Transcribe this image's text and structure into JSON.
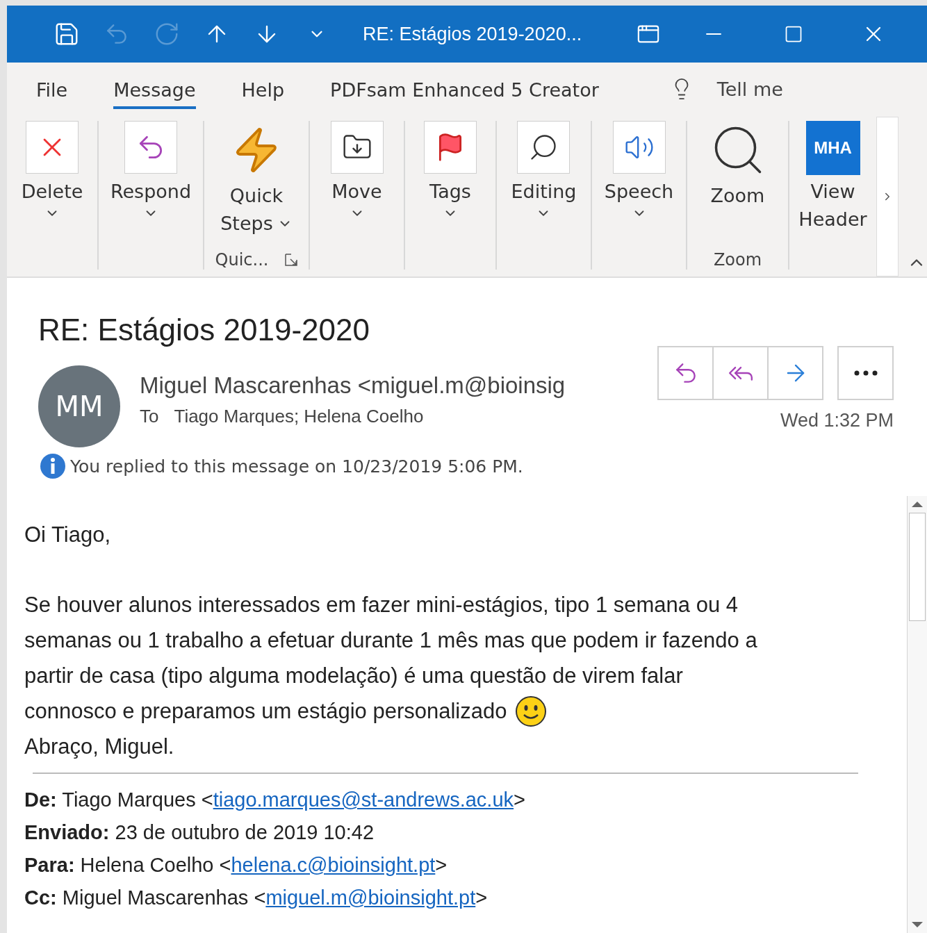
{
  "window": {
    "title": "RE: Estágios 2019-2020..."
  },
  "tabs": [
    {
      "label": "File",
      "selected": false
    },
    {
      "label": "Message",
      "selected": true
    },
    {
      "label": "Help",
      "selected": false
    },
    {
      "label": "PDFsam Enhanced 5 Creator",
      "selected": false
    }
  ],
  "tell_me": "Tell me",
  "ribbon": {
    "groups": [
      {
        "buttons": [
          {
            "lines": [
              "Delete"
            ],
            "dropdown": true
          }
        ]
      },
      {
        "buttons": [
          {
            "lines": [
              "Respond"
            ],
            "dropdown": true
          }
        ]
      },
      {
        "label": "Quic...",
        "buttons": [
          {
            "lines": [
              "Quick",
              "Steps"
            ],
            "dropdown": true
          }
        ]
      },
      {
        "buttons": [
          {
            "lines": [
              "Move"
            ],
            "dropdown": true
          }
        ]
      },
      {
        "buttons": [
          {
            "lines": [
              "Tags"
            ],
            "dropdown": true
          }
        ]
      },
      {
        "buttons": [
          {
            "lines": [
              "Editing"
            ],
            "dropdown": true
          }
        ]
      },
      {
        "buttons": [
          {
            "lines": [
              "Speech"
            ],
            "dropdown": true
          }
        ]
      },
      {
        "label": "Zoom",
        "buttons": [
          {
            "lines": [
              "Zoom"
            ],
            "dropdown": false
          }
        ]
      },
      {
        "buttons": [
          {
            "lines": [
              "View",
              "Header"
            ],
            "dropdown": false,
            "badge": "MHA"
          }
        ]
      }
    ]
  },
  "message": {
    "subject": "RE: Estágios 2019-2020",
    "avatar": "MM",
    "from": "Miguel Mascarenhas <miguel.m@bioinsig",
    "to_label": "To",
    "to": "Tiago Marques; Helena Coelho",
    "time": "Wed 1:32 PM",
    "info": "You replied to this message on 10/23/2019 5:06 PM.",
    "body": {
      "greeting": "Oi Tiago,",
      "paragraph_lines": [
        "Se houver alunos interessados em fazer mini-estágios, tipo 1 semana ou 4",
        "semanas ou 1 trabalho a efetuar durante 1 mês mas que podem ir fazendo a",
        "partir de casa (tipo alguma modelação) é uma questão de virem falar",
        "connosco e preparamos um estágio personalizado"
      ],
      "signoff": "Abraço, Miguel."
    },
    "quoted": [
      {
        "label": "De:",
        "before": "Tiago Marques <",
        "link": "tiago.marques@st-andrews.ac.uk",
        "after": ">"
      },
      {
        "label": "Enviado:",
        "before": "23 de outubro de 2019 10:42"
      },
      {
        "label": "Para:",
        "before": "Helena Coelho <",
        "link": "helena.c@bioinsight.pt",
        "after": ">"
      },
      {
        "label": "Cc:",
        "before": "Miguel Mascarenhas <",
        "link": "miguel.m@bioinsight.pt",
        "after": ">"
      }
    ]
  }
}
